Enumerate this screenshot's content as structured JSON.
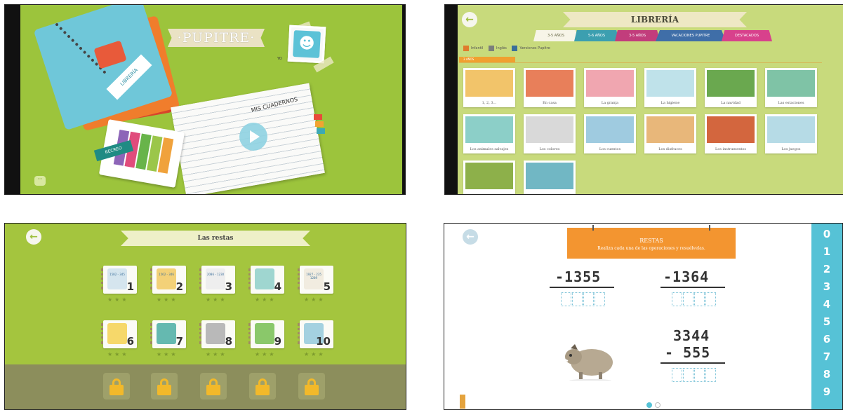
{
  "screens": {
    "home": {
      "title": "·PUPITRE·",
      "notebook_library_label": "LIBRERÍA",
      "profile_label": "YO",
      "my_notebooks_label": "MIS CUADERNOS",
      "recess_label": "RECREO",
      "play_icon": "play-icon",
      "chat_icon": "chat-icon"
    },
    "library": {
      "title": "LIBRERÍA",
      "back_icon": "back-arrow-icon",
      "age_tabs": [
        {
          "label": "3-5 AÑOS",
          "color": "#f7f5e8",
          "text_color": "#6a6a4a"
        },
        {
          "label": "5-6 AÑOS",
          "color": "#3c9fb0",
          "text_color": "#ffffff"
        },
        {
          "label": "3-5 AÑOS",
          "color": "#c23d7c",
          "text_color": "#ffffff"
        },
        {
          "label": "VACACIONES PUPITRE",
          "color": "#3f6ea8",
          "text_color": "#ffffff"
        },
        {
          "label": "DESTACADOS",
          "color": "#d8418c",
          "text_color": "#ffffff"
        }
      ],
      "filters": [
        {
          "label": "Infantil",
          "color": "#e07b2c"
        },
        {
          "label": "Inglés",
          "color": "#7b7e7c"
        },
        {
          "label": "Versiones Pupitre",
          "color": "#3a6f9a"
        }
      ],
      "section": "3 AÑOS",
      "books": [
        {
          "label": "1, 2, 3...",
          "color": "#f2c46a"
        },
        {
          "label": "En casa",
          "color": "#e87f5a"
        },
        {
          "label": "La granja",
          "color": "#f0a6b0"
        },
        {
          "label": "La higiene",
          "color": "#bfe2ea"
        },
        {
          "label": "La navidad",
          "color": "#6aa84f"
        },
        {
          "label": "Las estaciones",
          "color": "#7fc3a6"
        },
        {
          "label": "Los animales salvajes",
          "color": "#8ccfc8"
        },
        {
          "label": "Los colores",
          "color": "#d9d9d9"
        },
        {
          "label": "Los cuentos",
          "color": "#9fcbe0"
        },
        {
          "label": "Los disfraces",
          "color": "#e8b77a"
        },
        {
          "label": "Los instrumentos",
          "color": "#d3663e"
        },
        {
          "label": "Los juegos",
          "color": "#b6dbe6"
        },
        {
          "label": "",
          "color": "#8db04a"
        },
        {
          "label": "",
          "color": "#71b7c4"
        }
      ]
    },
    "levels": {
      "title": "Las restas",
      "back_icon": "back-arrow-icon",
      "levels": [
        {
          "number": "1",
          "art": "1582 - 345",
          "color": "#d5e5ee",
          "stars": "★★★"
        },
        {
          "number": "2",
          "art": "1562 - 346",
          "color": "#f3d178",
          "stars": "★★★"
        },
        {
          "number": "3",
          "art": "2086 - 1230",
          "color": "#eeeeee",
          "stars": "★★★"
        },
        {
          "number": "4",
          "art": "",
          "color": "#9fd6d0",
          "stars": "★★★"
        },
        {
          "number": "5",
          "art": "1927 - 235 1289",
          "color": "#f1ece0",
          "stars": "★★★"
        },
        {
          "number": "6",
          "art": "",
          "color": "#f6d86a",
          "stars": "★★★"
        },
        {
          "number": "7",
          "art": "",
          "color": "#65b9b0",
          "stars": "★★★"
        },
        {
          "number": "8",
          "art": "",
          "color": "#b9b9b9",
          "stars": "★★★"
        },
        {
          "number": "9",
          "art": "",
          "color": "#8ac86a",
          "stars": "★★★"
        },
        {
          "number": "10",
          "art": "",
          "color": "#a4d1e0",
          "stars": "★★★"
        }
      ],
      "locked_count": 5,
      "lock_icon": "lock-icon"
    },
    "exercise": {
      "title": "RESTAS",
      "instruction": "Realiza cada una de las operaciones y resuélvelas.",
      "back_icon": "back-arrow-icon",
      "problem_a": "-1355",
      "problem_b": "-1364",
      "problem_c_top": "3344",
      "problem_c_bottom": "- 555",
      "number_strip": [
        "0",
        "1",
        "2",
        "3",
        "4",
        "5",
        "6",
        "7",
        "8",
        "9"
      ],
      "page_dots": 2,
      "active_page": 1,
      "pencil_icon": "pencil-icon",
      "character": "boar-illustration"
    }
  },
  "colors": {
    "home_bg": "#9cc43c",
    "library_bg": "#c8da7c",
    "levels_bg": "#a4c53e",
    "locked_bg": "#8c8e5c",
    "exercise_accent": "#f39530",
    "number_strip": "#56c2d6"
  }
}
